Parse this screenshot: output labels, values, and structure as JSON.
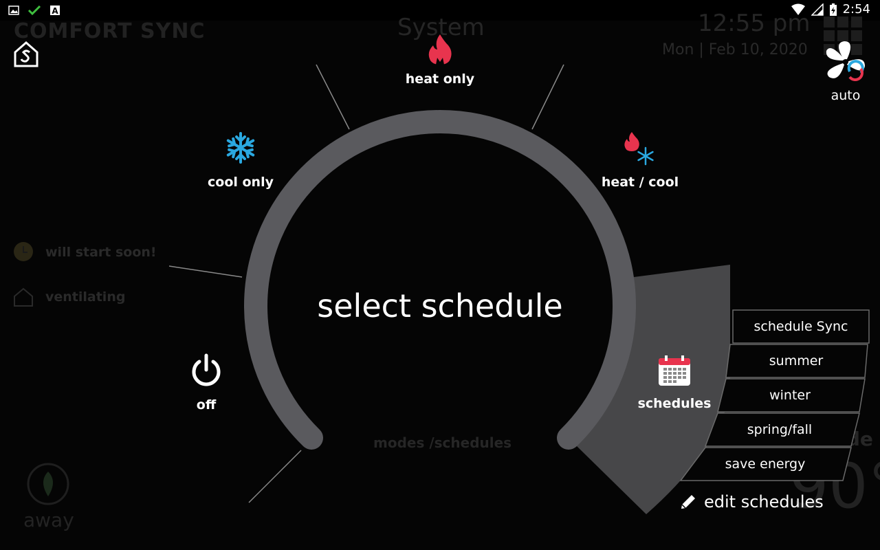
{
  "status_bar": {
    "time": "2:54",
    "icons": [
      "image-icon",
      "check-icon",
      "font-icon",
      "wifi-icon",
      "signal-icon",
      "battery-charging-icon"
    ]
  },
  "background": {
    "brand": "COMFORT SYNC",
    "system_title": "System",
    "time": "12:55 pm",
    "date": "Mon | Feb 10, 2020",
    "status1": "will start soon!",
    "status2": "ventilating",
    "modes_schedules": "modes /schedules",
    "away": "away",
    "outside": "outside",
    "outside_temp": "90°"
  },
  "dial": {
    "center_title": "select schedule",
    "modes": {
      "heat_only": "heat only",
      "cool_only": "cool only",
      "heat_cool": "heat / cool",
      "off": "off",
      "schedules": "schedules"
    }
  },
  "schedules": {
    "items": [
      "schedule Sync",
      "summer",
      "winter",
      "spring/fall",
      "save energy"
    ],
    "edit_label": "edit schedules"
  },
  "fan": {
    "label": "auto"
  },
  "colors": {
    "heat": "#e8344e",
    "cool": "#2aa8e0",
    "dial_track": "#5a5a5e",
    "selected_wedge": "#474749"
  }
}
